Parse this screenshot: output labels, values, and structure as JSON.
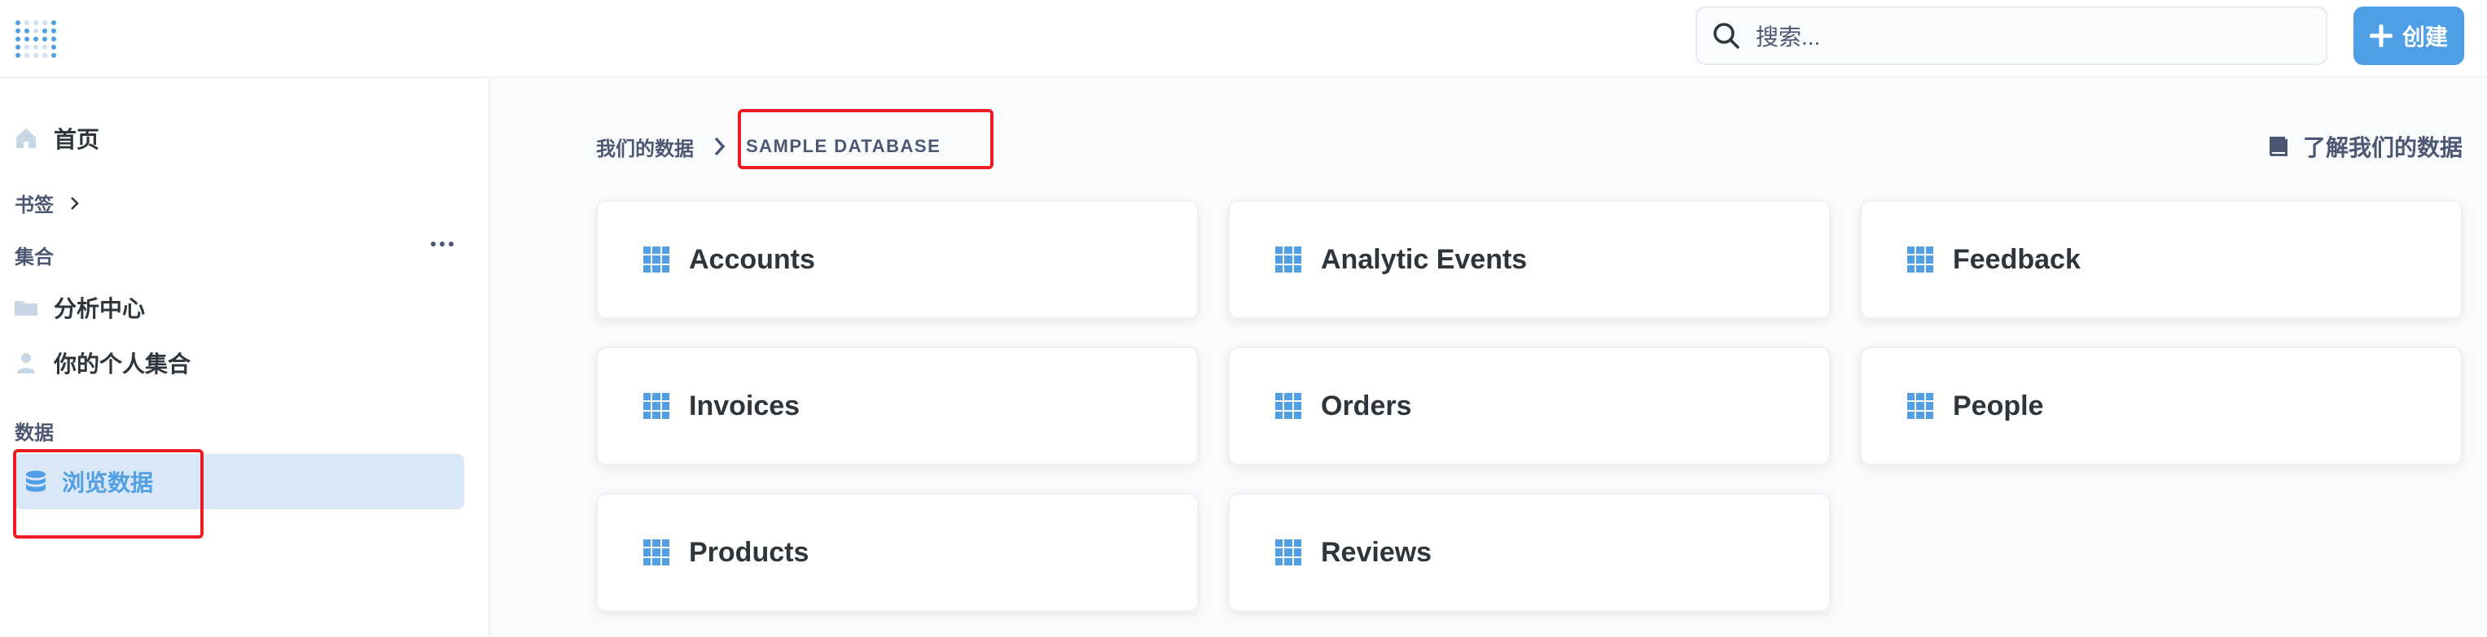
{
  "header": {
    "logo": "metabase-logo-icon",
    "search_placeholder": "搜索...",
    "create_label": "创建"
  },
  "sidebar": {
    "home_label": "首页",
    "bookmarks_label": "书签",
    "collections_label": "集合",
    "collections": [
      {
        "label": "分析中心",
        "icon": "folder-icon"
      },
      {
        "label": "你的个人集合",
        "icon": "person-icon"
      }
    ],
    "data_label": "数据",
    "browse_label": "浏览数据"
  },
  "breadcrumb": {
    "root": "我们的数据",
    "current": "SAMPLE DATABASE"
  },
  "learn_link": "了解我们的数据",
  "tables": [
    "Accounts",
    "Analytic Events",
    "Feedback",
    "Invoices",
    "Orders",
    "People",
    "Products",
    "Reviews"
  ],
  "colors": {
    "brand": "#509EE3",
    "text_dark": "#2E353B",
    "text_medium": "#4C5773",
    "highlight": "#EC1C24"
  }
}
